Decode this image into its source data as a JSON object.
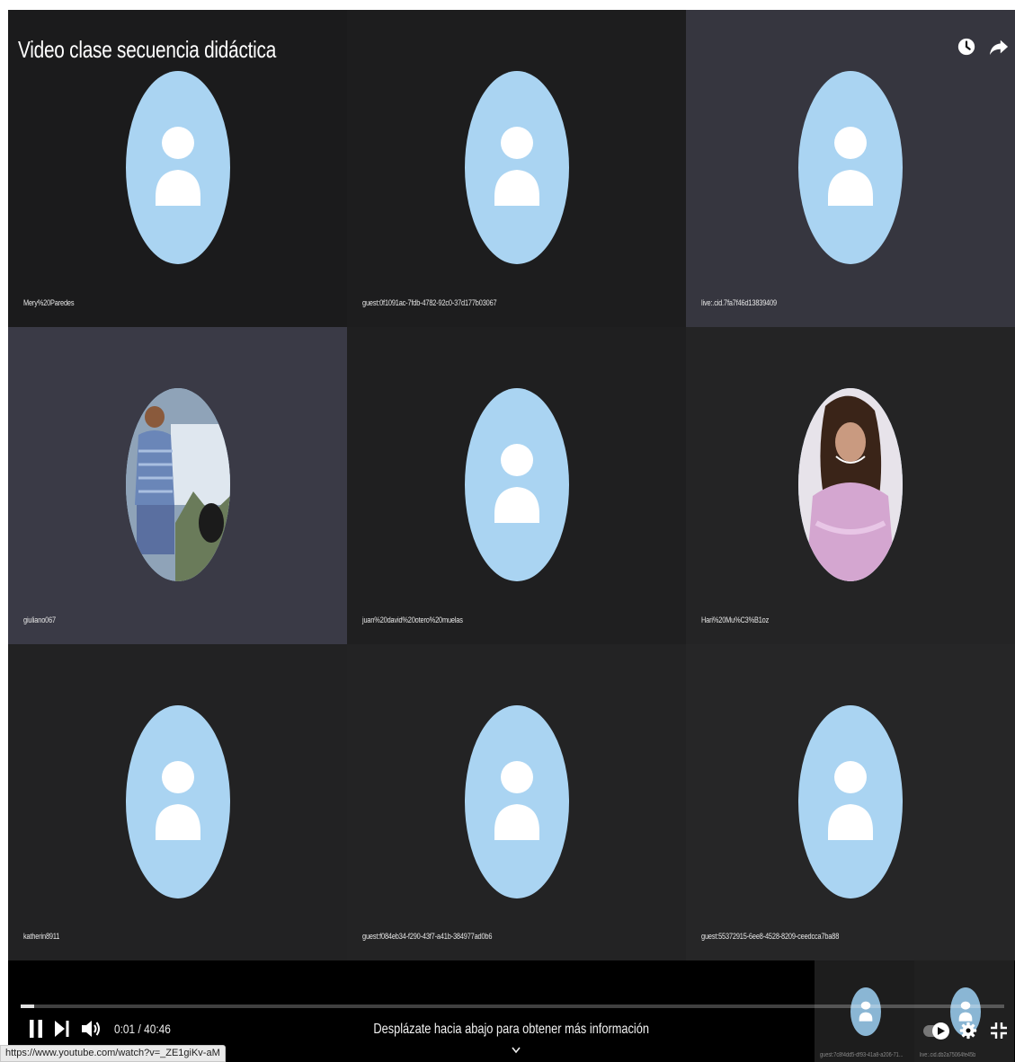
{
  "player": {
    "title": "Video clase secuencia didáctica",
    "icons": {
      "watch_later": "clock-icon",
      "share": "share-icon"
    },
    "participants": [
      {
        "name": "Mery%20Paredes",
        "avatar": "default",
        "tile_color": "#1b1b1c"
      },
      {
        "name": "guest:0f1091ac-7fdb-4782-92c0-37d177b03067",
        "avatar": "default",
        "tile_color": "#1d1d1e"
      },
      {
        "name": "live:.cid.7fa7f46d13839409",
        "avatar": "default",
        "tile_color": "#36363f"
      },
      {
        "name": "giuliano067",
        "avatar": "photo-boy",
        "tile_color": "#3a3a46"
      },
      {
        "name": "juan%20david%20otero%20muelas",
        "avatar": "default",
        "tile_color": "#1f1f20"
      },
      {
        "name": "Hari%20Mu%C3%B1oz",
        "avatar": "photo-girl",
        "tile_color": "#242425"
      },
      {
        "name": "katherin8911",
        "avatar": "default",
        "tile_color": "#222223"
      },
      {
        "name": "guest:f084eb34-f290-43f7-a41b-384977ad0b6",
        "avatar": "default",
        "tile_color": "#232324"
      },
      {
        "name": "guest:55372915-6ee8-4528-8209-ceedcca7ba88",
        "avatar": "default",
        "tile_color": "#262627"
      }
    ],
    "mini_participants": [
      {
        "name": "guest:7c8f4dd5-df93-41a8-a206-71..."
      },
      {
        "name": "live:.cid.db2a75064fe45b"
      }
    ],
    "controls": {
      "time": "0:01 / 40:46",
      "progress": 0.014,
      "scroll_hint": "Desplázate hacia abajo para obtener más información"
    },
    "colors": {
      "avatar_bg": "#aad4f2",
      "silhouette": "#ffffff"
    }
  },
  "statusbar": {
    "url": "https://www.youtube.com/watch?v=_ZE1giKv-aM"
  }
}
